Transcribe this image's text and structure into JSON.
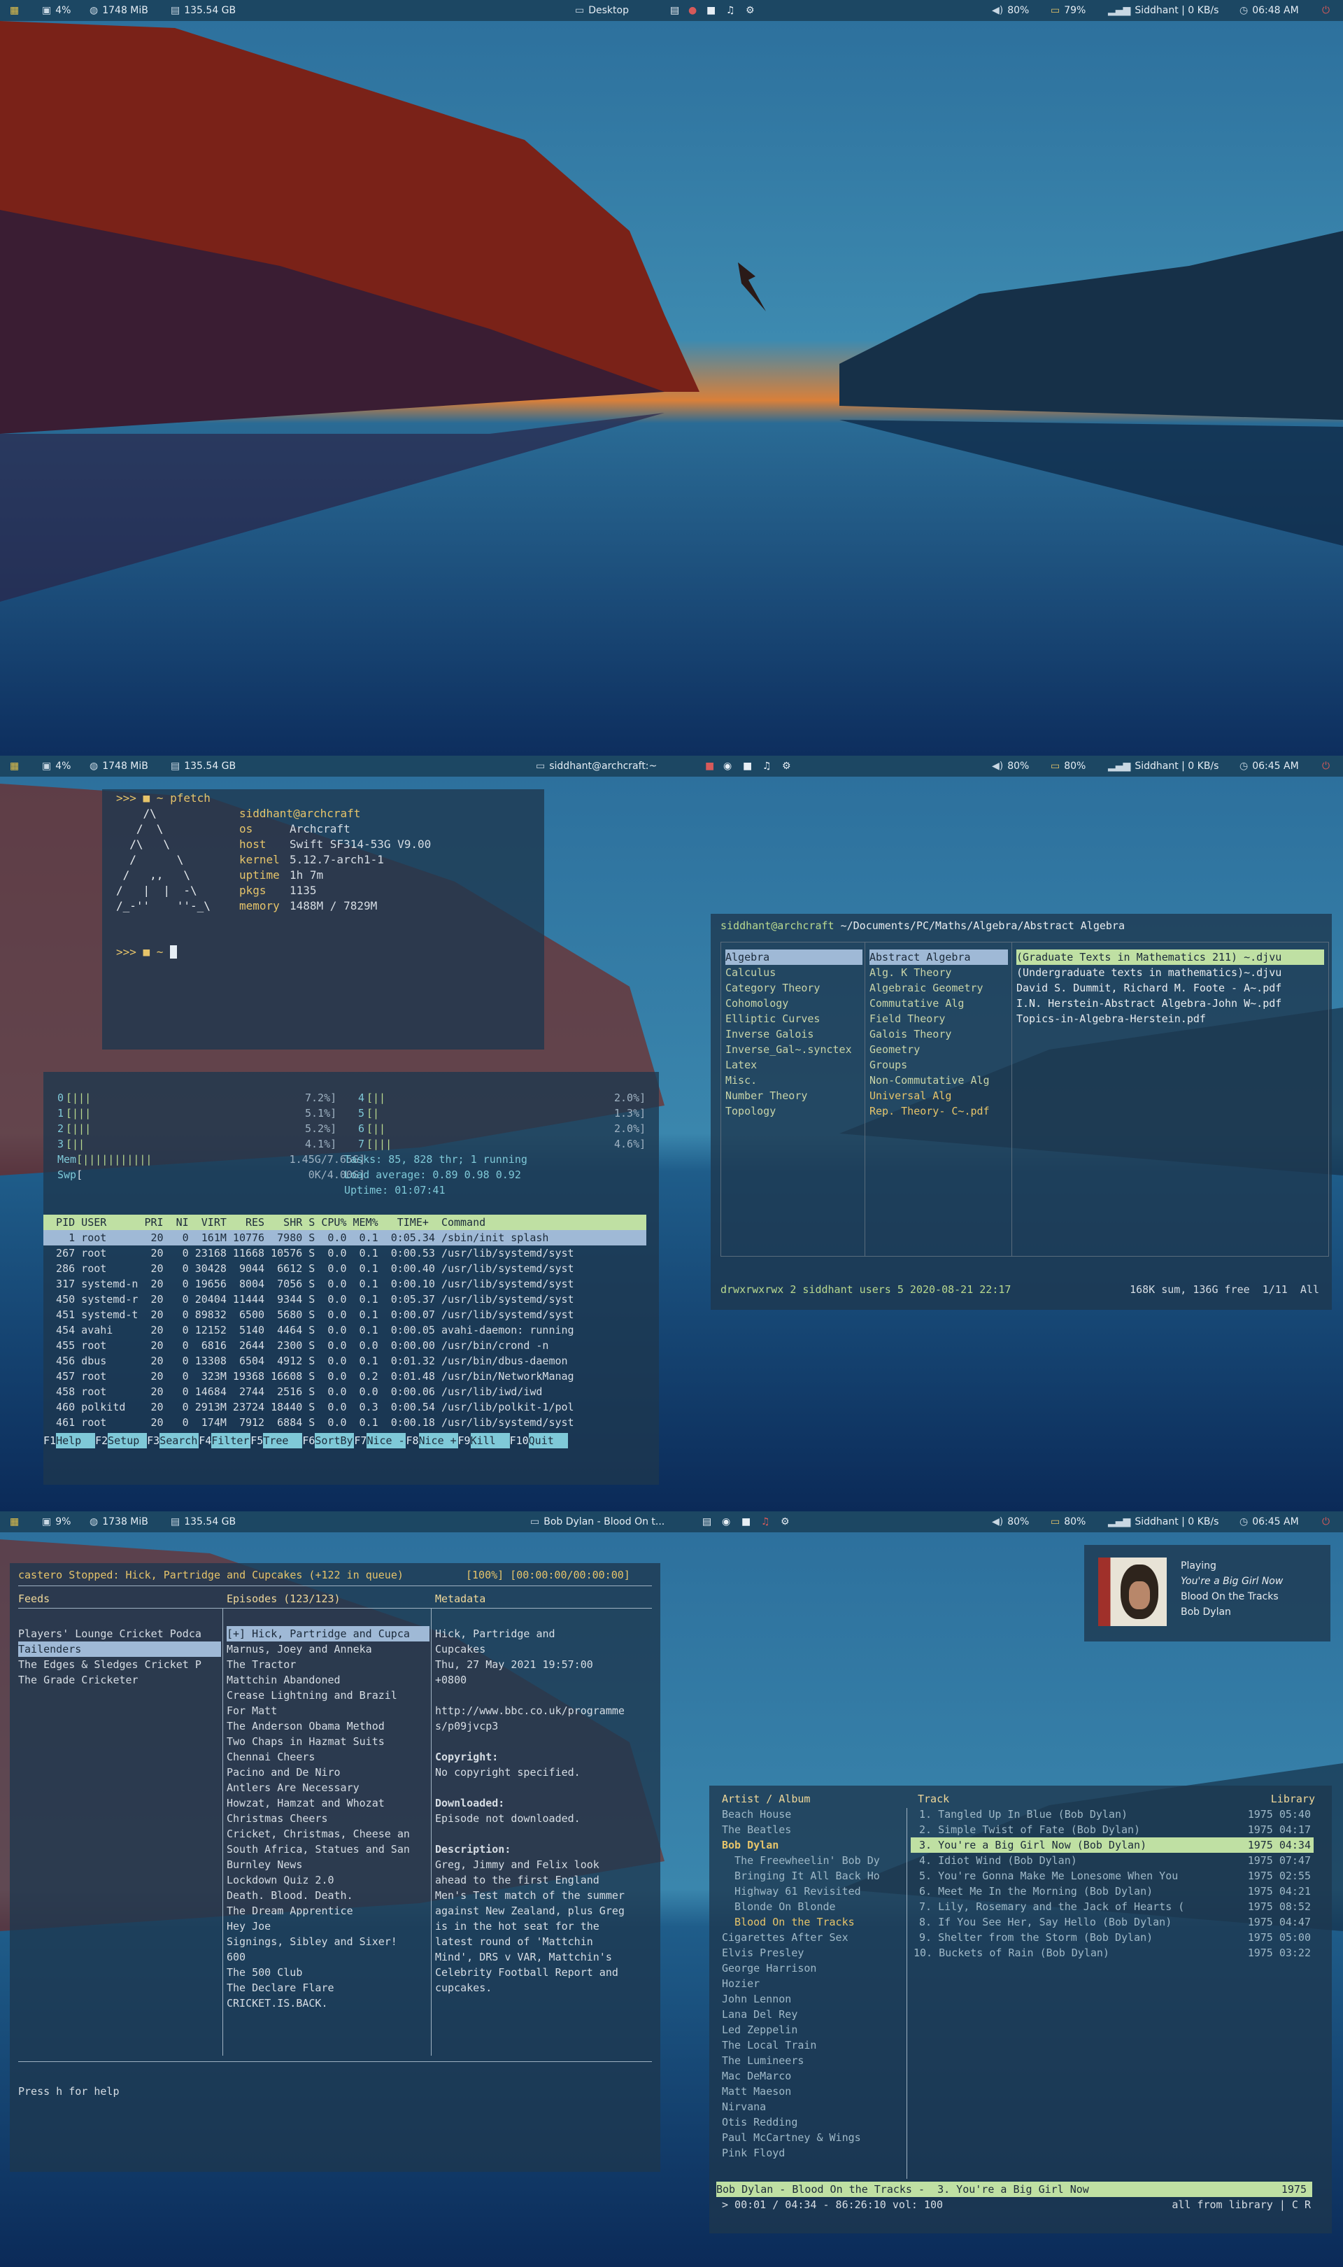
{
  "colors": {
    "bar_bg": "#1c4763",
    "accent_yellow": "#e6c46a",
    "accent_green": "#bfe0a3",
    "highlight_blue": "#9fb9d6"
  },
  "screens": [
    {
      "bar": {
        "cpu": "4%",
        "ram": "1748 MiB",
        "disk": "135.54 GB",
        "window_title": "Desktop",
        "volume": "80%",
        "battery": "79%",
        "network": "Siddhant | 0 KB/s",
        "time": "06:48 AM"
      }
    },
    {
      "bar": {
        "cpu": "4%",
        "ram": "1748 MiB",
        "disk": "135.54 GB",
        "window_title": "siddhant@archcraft:~",
        "volume": "80%",
        "battery": "80%",
        "network": "Siddhant | 0 KB/s",
        "time": "06:45 AM"
      },
      "pfetch": {
        "prompt1": ">>> ■ ~ pfetch",
        "logo": [
          "    /\\",
          "   /  \\",
          "  /\\   \\",
          "  /      \\",
          " /   ,,   \\",
          "/   |  |  -\\",
          "/_-''    ''-_\\"
        ],
        "user": "siddhant@archcraft",
        "rows": [
          [
            "os",
            "Archcraft"
          ],
          [
            "host",
            "Swift SF314-53G V9.00"
          ],
          [
            "kernel",
            "5.12.7-arch1-1"
          ],
          [
            "uptime",
            "1h 7m"
          ],
          [
            "pkgs",
            "1135"
          ],
          [
            "memory",
            "1488M / 7829M"
          ]
        ],
        "prompt2": ">>> ■ ~ "
      },
      "ranger": {
        "path_user": "siddhant@archcraft",
        "path": "~/Documents/PC/Maths/Algebra/Abstract Algebra",
        "col1": [
          "Algebra",
          "Calculus",
          "Category Theory",
          "Cohomology",
          "Elliptic Curves",
          "Inverse Galois",
          "Inverse_Gal~.synctex",
          "Latex",
          "Misc.",
          "Number Theory",
          "Topology"
        ],
        "col2": [
          "Abstract Algebra",
          "Alg. K Theory",
          "Algebraic Geometry",
          "Commutative Alg",
          "Field Theory",
          "Galois Theory",
          "Geometry",
          "Groups",
          "Non-Commutative Alg",
          "Universal Alg",
          "Rep. Theory- C~.pdf"
        ],
        "col3": [
          "(Graduate Texts in Mathematics 211) ~.djvu",
          "(Undergraduate texts in mathematics)~.djvu",
          "David S. Dummit, Richard M. Foote - A~.pdf",
          "I.N. Herstein-Abstract Algebra-John W~.pdf",
          "Topics-in-Algebra-Herstein.pdf"
        ],
        "status_left": "drwxrwxrwx 2 siddhant users 5 2020-08-21 22:17",
        "status_right": "168K sum, 136G free  1/11  All"
      },
      "htop": {
        "cpus_left": [
          [
            "0",
            "[|||",
            "7.2%]"
          ],
          [
            "1",
            "[|||",
            "5.1%]"
          ],
          [
            "2",
            "[|||",
            "5.2%]"
          ],
          [
            "3",
            "[||",
            "4.1%]"
          ]
        ],
        "cpus_right": [
          [
            "4",
            "[||",
            "2.0%]"
          ],
          [
            "5",
            "[|",
            "1.3%]"
          ],
          [
            "6",
            "[||",
            "2.0%]"
          ],
          [
            "7",
            "[|||",
            "4.6%]"
          ]
        ],
        "mem": [
          "Mem",
          "[|||||||||||",
          "1.45G/7.65G]"
        ],
        "swp": [
          "Swp",
          "[",
          "0K/4.00G]"
        ],
        "tasks": "Tasks: 85, 828 thr; 1 running",
        "load": "Load average: 0.89 0.98 0.92",
        "uptime": "Uptime: 01:07:41",
        "header": "  PID USER      PRI  NI  VIRT   RES   SHR S CPU% MEM%   TIME+  Command",
        "rows": [
          "    1 root       20   0  161M 10776  7980 S  0.0  0.1  0:05.34 /sbin/init splash",
          "  267 root       20   0 23168 11668 10576 S  0.0  0.1  0:00.53 /usr/lib/systemd/syst",
          "  286 root       20   0 30428  9044  6612 S  0.0  0.1  0:00.40 /usr/lib/systemd/syst",
          "  317 systemd-n  20   0 19656  8004  7056 S  0.0  0.1  0:00.10 /usr/lib/systemd/syst",
          "  450 systemd-r  20   0 20404 11444  9344 S  0.0  0.1  0:05.37 /usr/lib/systemd/syst",
          "  451 systemd-t  20   0 89832  6500  5680 S  0.0  0.1  0:00.07 /usr/lib/systemd/syst",
          "  454 avahi      20   0 12152  5140  4464 S  0.0  0.1  0:00.05 avahi-daemon: running",
          "  455 root       20   0  6816  2644  2300 S  0.0  0.0  0:00.00 /usr/bin/crond -n",
          "  456 dbus       20   0 13308  6504  4912 S  0.0  0.1  0:01.32 /usr/bin/dbus-daemon",
          "  457 root       20   0  323M 19368 16608 S  0.0  0.2  0:01.48 /usr/bin/NetworkManag",
          "  458 root       20   0 14684  2744  2516 S  0.0  0.0  0:00.06 /usr/lib/iwd/iwd",
          "  460 polkitd    20   0 2913M 23724 18440 S  0.0  0.3  0:00.54 /usr/lib/polkit-1/pol",
          "  461 root       20   0  174M  7912  6884 S  0.0  0.1  0:00.18 /usr/lib/systemd/syst"
        ],
        "fkeys": [
          [
            "F1",
            "Help"
          ],
          [
            "F2",
            "Setup"
          ],
          [
            "F3",
            "Search"
          ],
          [
            "F4",
            "Filter"
          ],
          [
            "F5",
            "Tree"
          ],
          [
            "F6",
            "SortBy"
          ],
          [
            "F7",
            "Nice -"
          ],
          [
            "F8",
            "Nice +"
          ],
          [
            "F9",
            "Kill"
          ],
          [
            "F10",
            "Quit"
          ]
        ]
      }
    },
    {
      "bar": {
        "cpu": "9%",
        "ram": "1738 MiB",
        "disk": "135.54 GB",
        "window_title": "Bob Dylan - Blood On t...",
        "volume": "80%",
        "battery": "80%",
        "network": "Siddhant | 0 KB/s",
        "time": "06:45 AM"
      },
      "castero": {
        "status": "castero Stopped: Hick, Partridge and Cupcakes (+122 in queue)",
        "progress": "[100%] [00:00:00/00:00:00]",
        "feeds_title": "Feeds",
        "feeds": [
          "Players' Lounge Cricket Podca",
          "Tailenders",
          "The Edges & Sledges Cricket P",
          "The Grade Cricketer"
        ],
        "episodes_title": "Episodes (123/123)",
        "episodes": [
          "[+] Hick, Partridge and Cupca",
          "Marnus, Joey and Anneka",
          "The Tractor",
          "Mattchin Abandoned",
          "Crease Lightning and Brazil",
          "For Matt",
          "The Anderson Obama Method",
          "Two Chaps in Hazmat Suits",
          "Chennai Cheers",
          "Pacino and De Niro",
          "Antlers Are Necessary",
          "Howzat, Hamzat and Whozat",
          "Christmas Cheers",
          "Cricket, Christmas, Cheese an",
          "South Africa, Statues and San",
          "Burnley News",
          "Lockdown Quiz 2.0",
          "Death. Blood. Death.",
          "The Dream Apprentice",
          "Hey Joe",
          "Signings, Sibley and Sixer!",
          "600",
          "The 500 Club",
          "The Declare Flare",
          "CRICKET.IS.BACK."
        ],
        "metadata_title": "Metadata",
        "metadata": [
          "Hick, Partridge and",
          "Cupcakes",
          "Thu, 27 May 2021 19:57:00",
          "+0800",
          "",
          "http://www.bbc.co.uk/programme",
          "s/p09jvcp3",
          "",
          "Copyright:",
          "No copyright specified.",
          "",
          "Downloaded:",
          "Episode not downloaded.",
          "",
          "Description:",
          "Greg, Jimmy and Felix look",
          "ahead to the first England",
          "Men's Test match of the summer",
          "against New Zealand, plus Greg",
          "is in the hot seat for the",
          "latest round of 'Mattchin",
          "Mind', DRS v VAR, Mattchin's",
          "Celebrity Football Report and",
          "cupcakes."
        ],
        "help": "Press h for help"
      },
      "notification": {
        "lines": [
          "Playing",
          "You're a Big Girl Now",
          "Blood On the Tracks",
          "Bob Dylan"
        ]
      },
      "cmus": {
        "left_title": "Artist / Album",
        "artists": [
          "Beach House",
          "The Beatles",
          "Bob Dylan",
          "  The Freewheelin' Bob Dy",
          "  Bringing It All Back Ho",
          "  Highway 61 Revisited",
          "  Blonde On Blonde",
          "  Blood On the Tracks",
          "Cigarettes After Sex",
          "Elvis Presley",
          "George Harrison",
          "Hozier",
          "John Lennon",
          "Lana Del Rey",
          "Led Zeppelin",
          "The Local Train",
          "The Lumineers",
          "Mac DeMarco",
          "Matt Maeson",
          "Nirvana",
          "Otis Redding",
          "Paul McCartney & Wings",
          "Pink Floyd"
        ],
        "track_title": "Track",
        "library_title": "Library",
        "tracks": [
          [
            "1. Tangled Up In Blue (Bob Dylan)",
            "1975 05:40"
          ],
          [
            "2. Simple Twist of Fate (Bob Dylan)",
            "1975 04:17"
          ],
          [
            "3. You're a Big Girl Now (Bob Dylan)",
            "1975 04:34"
          ],
          [
            "4. Idiot Wind (Bob Dylan)",
            "1975 07:47"
          ],
          [
            "5. You're Gonna Make Me Lonesome When You",
            "1975 02:55"
          ],
          [
            "6. Meet Me In the Morning (Bob Dylan)",
            "1975 04:21"
          ],
          [
            "7. Lily, Rosemary and the Jack of Hearts (",
            "1975 08:52"
          ],
          [
            "8. If You See Her, Say Hello (Bob Dylan)",
            "1975 04:47"
          ],
          [
            "9. Shelter from the Storm (Bob Dylan)",
            "1975 05:00"
          ],
          [
            "10. Buckets of Rain (Bob Dylan)",
            "1975 03:22"
          ]
        ],
        "now_playing": "Bob Dylan - Blood On the Tracks -  3. You're a Big Girl Now",
        "now_year": "1975",
        "status_left": "> 00:01 / 04:34 - 86:26:10 vol: 100",
        "status_right": "all from library | C R"
      }
    }
  ]
}
